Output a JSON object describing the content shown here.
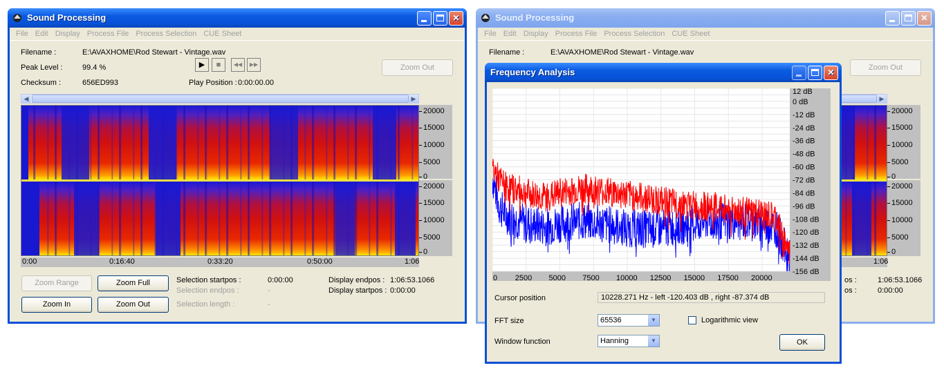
{
  "window_left": {
    "title": "Sound Processing",
    "menu": [
      "File",
      "Edit",
      "Display",
      "Process File",
      "Process Selection",
      "CUE Sheet"
    ],
    "info": {
      "filename_label": "Filename :",
      "filename_value": "E:\\AVAXHOME\\Rod Stewart - Vintage.wav",
      "peak_label": "Peak Level :",
      "peak_value": "99.4 %",
      "checksum_label": "Checksum :",
      "checksum_value": "656ED993",
      "play_position_label": "Play Position :",
      "play_position_value": "0:00:00.00"
    },
    "transport": {
      "play": "▶",
      "stop": "■",
      "rewind": "◀◀",
      "forward": "▶▶"
    },
    "zoom_out_top": "Zoom Out",
    "freq_ticks": [
      "20000",
      "15000",
      "10000",
      "5000",
      "0"
    ],
    "time_ticks": [
      "0:00",
      "0:16:40",
      "0:33:20",
      "0:50:00",
      "1:06"
    ],
    "buttons": {
      "zoom_range": "Zoom Range",
      "zoom_full": "Zoom Full",
      "zoom_in": "Zoom In",
      "zoom_out": "Zoom Out"
    },
    "selection": {
      "startpos_label": "Selection startpos :",
      "startpos_value": "0:00:00",
      "endpos_label": "Selection endpos :",
      "endpos_value": "-",
      "length_label": "Selection length :",
      "length_value": "-"
    },
    "display": {
      "endpos_label": "Display endpos :",
      "endpos_value": "1:06:53.1066",
      "startpos_label": "Display startpos :",
      "startpos_value": "0:00:00"
    }
  },
  "window_right": {
    "title": "Sound Processing",
    "menu": [
      "File",
      "Edit",
      "Display",
      "Process File",
      "Process Selection",
      "CUE Sheet"
    ],
    "filename_label": "Filename :",
    "filename_value": "E:\\AVAXHOME\\Rod Stewart - Vintage.wav",
    "zoom_out_top": "Zoom Out",
    "freq_ticks": [
      "20000",
      "15000",
      "10000",
      "5000",
      "0"
    ],
    "time_tick": "1:06",
    "display_endpos_partial": "os :",
    "display_endpos_value": "1:06:53.1066",
    "display_startpos_partial": "os :",
    "display_startpos_value": "0:00:00"
  },
  "dialog": {
    "title": "Frequency Analysis",
    "db_ticks": [
      "12 dB",
      "0 dB",
      "-12 dB",
      "-24 dB",
      "-36 dB",
      "-48 dB",
      "-60 dB",
      "-72 dB",
      "-84 dB",
      "-96 dB",
      "-108 dB",
      "-120 dB",
      "-132 dB",
      "-144 dB",
      "-156 dB"
    ],
    "hz_ticks": [
      "0",
      "2500",
      "5000",
      "7500",
      "10000",
      "12500",
      "15000",
      "17500",
      "20000"
    ],
    "cursor_label": "Cursor position",
    "cursor_value": "10228.271 Hz  -  left -120.403 dB , right -87.374 dB",
    "fft_label": "FFT size",
    "fft_value": "65536",
    "log_label": "Logarithmic view",
    "window_label": "Window function",
    "window_value": "Hanning",
    "ok": "OK"
  },
  "colors": {
    "left_channel": "#0000ff",
    "right_channel": "#ff0000",
    "xp_blue": "#0a4fd8",
    "face": "#ece9d8"
  },
  "chart_data": {
    "type": "line",
    "xlim": [
      0,
      22050
    ],
    "ylim": [
      -156,
      12
    ],
    "x_ticks": [
      0,
      2500,
      5000,
      7500,
      10000,
      12500,
      15000,
      17500,
      20000
    ],
    "y_ticks": [
      12,
      0,
      -12,
      -24,
      -36,
      -48,
      -60,
      -72,
      -84,
      -96,
      -108,
      -120,
      -132,
      -144,
      -156
    ],
    "grid": true,
    "series": [
      {
        "color": "#ff0000",
        "x": [
          0,
          500,
          1000,
          2000,
          3000,
          4000,
          5000,
          6000,
          7000,
          8000,
          9000,
          10000,
          11000,
          12000,
          13000,
          14000,
          15000,
          16000,
          17000,
          18000,
          19000,
          20000,
          21000,
          22050
        ],
        "y": [
          -60,
          -72,
          -78,
          -82,
          -86,
          -88,
          -84,
          -82,
          -80,
          -82,
          -84,
          -86,
          -88,
          -90,
          -93,
          -95,
          -96,
          -97,
          -98,
          -100,
          -102,
          -104,
          -108,
          -140
        ]
      },
      {
        "color": "#0000ff",
        "x": [
          0,
          500,
          1000,
          2000,
          3000,
          4000,
          5000,
          6000,
          7000,
          8000,
          9000,
          10000,
          11000,
          12000,
          13000,
          14000,
          15000,
          16000,
          17000,
          18000,
          19000,
          20000,
          21000,
          22050
        ],
        "y": [
          -70,
          -96,
          -104,
          -110,
          -113,
          -115,
          -112,
          -110,
          -110,
          -112,
          -114,
          -116,
          -117,
          -117,
          -116,
          -114,
          -112,
          -110,
          -110,
          -110,
          -110,
          -112,
          -115,
          -145
        ]
      }
    ]
  }
}
